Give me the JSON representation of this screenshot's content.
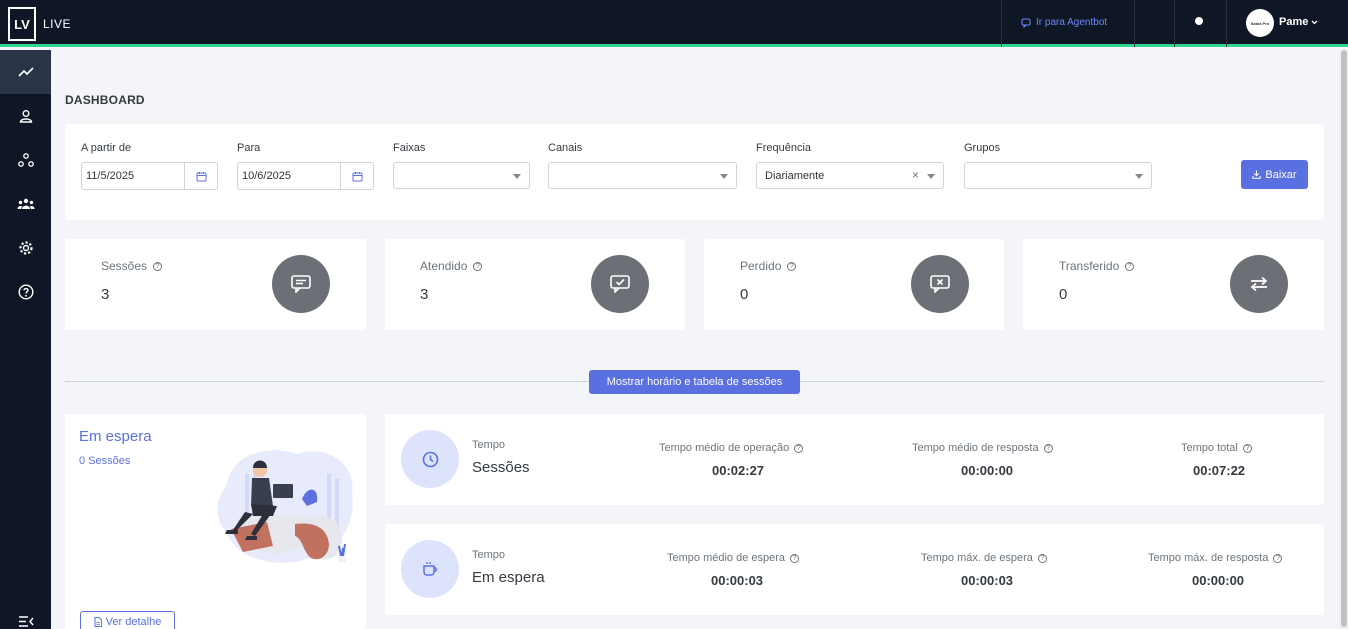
{
  "header": {
    "logo_text": "LV",
    "brand": "LIVE",
    "agentbot_link": "Ir para Agentbot",
    "avatar_text": "Sabiá Pro",
    "user_name": "Pame"
  },
  "sidebar": {
    "items": [
      {
        "icon": "trending-up-icon",
        "active": true
      },
      {
        "icon": "user-icon"
      },
      {
        "icon": "network-icon"
      },
      {
        "icon": "team-icon"
      },
      {
        "icon": "gear-icon"
      },
      {
        "icon": "help-circle-icon"
      }
    ],
    "collapse_icon": "menu-collapse-icon"
  },
  "page_title": "DASHBOARD",
  "filters": {
    "from_label": "A partir de",
    "from_value": "11/5/2025",
    "to_label": "Para",
    "to_value": "10/6/2025",
    "ranges_label": "Faixas",
    "ranges_value": "",
    "channels_label": "Canais",
    "channels_value": "",
    "frequency_label": "Frequência",
    "frequency_value": "Diariamente",
    "groups_label": "Grupos",
    "groups_value": "",
    "download_button": "Baixar"
  },
  "stats": [
    {
      "label": "Sessões",
      "value": "3",
      "icon": "chat-icon"
    },
    {
      "label": "Atendido",
      "value": "3",
      "icon": "chat-check-icon"
    },
    {
      "label": "Perdido",
      "value": "0",
      "icon": "chat-x-icon"
    },
    {
      "label": "Transferido",
      "value": "0",
      "icon": "transfer-icon"
    }
  ],
  "toggle_table_button": "Mostrar horário e tabela de sessões",
  "waiting": {
    "title": "Em espera",
    "subtitle": "0 Sessões",
    "detail_button": "Ver detalhe"
  },
  "metrics": [
    {
      "small": "Tempo",
      "big": "Sessões",
      "icon": "clock-icon",
      "items": [
        {
          "label": "Tempo médio de operação",
          "value": "00:02:27"
        },
        {
          "label": "Tempo médio de resposta",
          "value": "00:00:00"
        },
        {
          "label": "Tempo total",
          "value": "00:07:22"
        }
      ]
    },
    {
      "small": "Tempo",
      "big": "Em espera",
      "icon": "coffee-icon",
      "items": [
        {
          "label": "Tempo médio de espera",
          "value": "00:00:03"
        },
        {
          "label": "Tempo máx. de espera",
          "value": "00:00:03"
        },
        {
          "label": "Tempo máx. de resposta",
          "value": "00:00:00"
        }
      ]
    }
  ],
  "colors": {
    "topbar": "#0f1726",
    "accent_green": "#2fd68f",
    "primary": "#5a6fe0",
    "stat_circle": "#6c6f75",
    "metric_circle": "#dde3fb"
  }
}
